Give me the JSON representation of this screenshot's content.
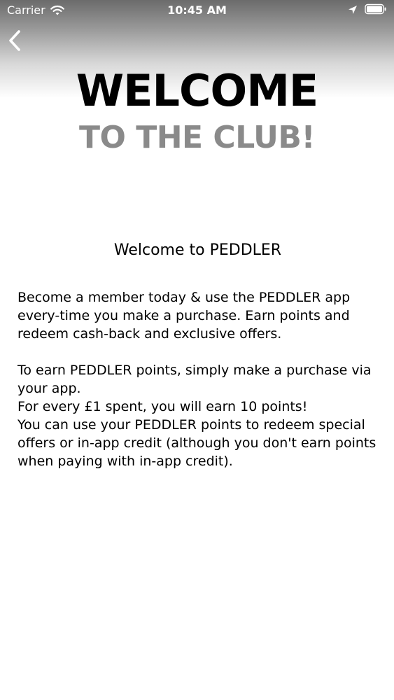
{
  "status_bar": {
    "carrier": "Carrier",
    "time": "10:45 AM",
    "icons": [
      "wifi-icon",
      "location-icon",
      "battery-icon"
    ]
  },
  "nav": {
    "back_icon": "chevron-left-icon"
  },
  "logo": {
    "line1": "WELCOME",
    "line2": "TO THE CLUB!",
    "line1_color": "#000000",
    "line2_color": "#8a8a8a"
  },
  "content": {
    "title": "Welcome to PEDDLER",
    "paragraph1": "Become a member today & use the PEDDLER  app every-time you make a purchase. Earn points and redeem cash-back and exclusive offers.",
    "paragraph2_line1": "To earn PEDDLER points, simply make a purchase via your app.",
    "paragraph2_line2": "For every £1 spent, you will earn 10 points!",
    "paragraph2_line3": "You can use your PEDDLER points to redeem special offers or in-app credit (although you don't earn points when paying with in-app credit)."
  },
  "colors": {
    "header_gradient_top": "#6b6b6b",
    "background": "#ffffff",
    "text": "#000000"
  }
}
